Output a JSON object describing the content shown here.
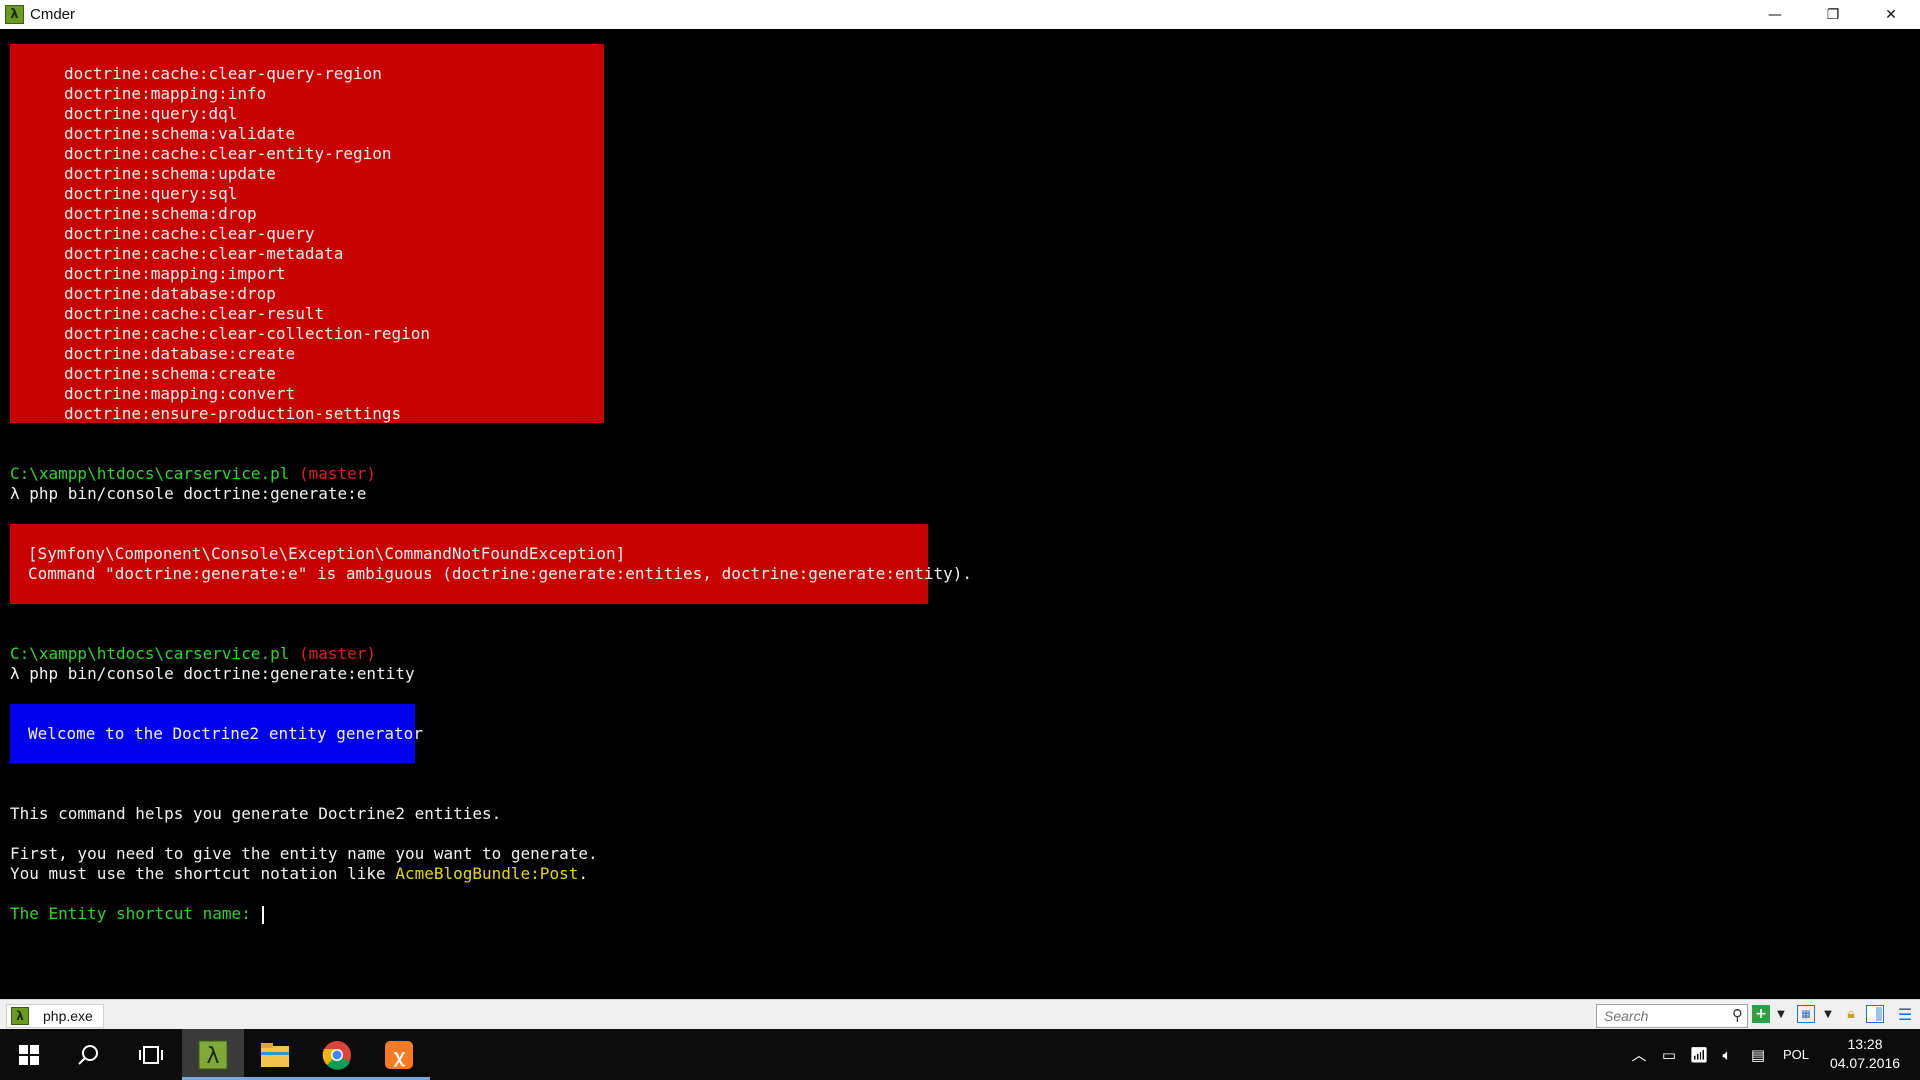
{
  "window": {
    "title": "Cmder",
    "logo_glyph": "λ",
    "minimize_glyph": "—",
    "restore_glyph": "❐",
    "close_glyph": "✕"
  },
  "console": {
    "list_items": [
      "doctrine:cache:clear-query-region",
      "doctrine:mapping:info",
      "doctrine:query:dql",
      "doctrine:schema:validate",
      "doctrine:cache:clear-entity-region",
      "doctrine:schema:update",
      "doctrine:query:sql",
      "doctrine:schema:drop",
      "doctrine:cache:clear-query",
      "doctrine:cache:clear-metadata",
      "doctrine:mapping:import",
      "doctrine:database:drop",
      "doctrine:cache:clear-result",
      "doctrine:cache:clear-collection-region",
      "doctrine:database:create",
      "doctrine:schema:create",
      "doctrine:mapping:convert",
      "doctrine:ensure-production-settings"
    ],
    "prompt1": {
      "path": "C:\\xampp\\htdocs\\carservice.pl",
      "branch": "(master)",
      "command": "λ php bin/console doctrine:generate:e"
    },
    "error": {
      "line1": "[Symfony\\Component\\Console\\Exception\\CommandNotFoundException]",
      "line2": "Command \"doctrine:generate:e\" is ambiguous (doctrine:generate:entities, doctrine:generate:entity)."
    },
    "prompt2": {
      "path": "C:\\xampp\\htdocs\\carservice.pl",
      "branch": "(master)",
      "command": "λ php bin/console doctrine:generate:entity"
    },
    "welcome": "Welcome to the Doctrine2 entity generator",
    "help1": "This command helps you generate Doctrine2 entities.",
    "help2": "First, you need to give the entity name you want to generate.",
    "help3_prefix": "You must use the shortcut notation like ",
    "help3_example": "AcmeBlogBundle:Post",
    "help3_suffix": ".",
    "question": "The Entity shortcut name: "
  },
  "tabbar": {
    "tab_label": "php.exe",
    "tab_logo_glyph": "λ",
    "search_placeholder": "Search",
    "icons": [
      "search-icon",
      "new-console-icon",
      "dropdown-icon",
      "split-view-icon",
      "dropdown-icon",
      "lock-icon",
      "layout-icon",
      "menu-icon"
    ]
  },
  "taskbar": {
    "apps": [
      "windows-start-icon",
      "search-icon",
      "task-view-icon",
      "cmder-icon",
      "file-explorer-icon",
      "chrome-icon",
      "xampp-icon"
    ],
    "language": "POL",
    "time": "13:28",
    "date": "04.07.2016"
  },
  "colors": {
    "error_bg": "#c80000",
    "welcome_bg": "#0000ee",
    "prompt_path": "#2bd62b",
    "prompt_branch": "#e02020",
    "example_text": "#e6d800"
  }
}
